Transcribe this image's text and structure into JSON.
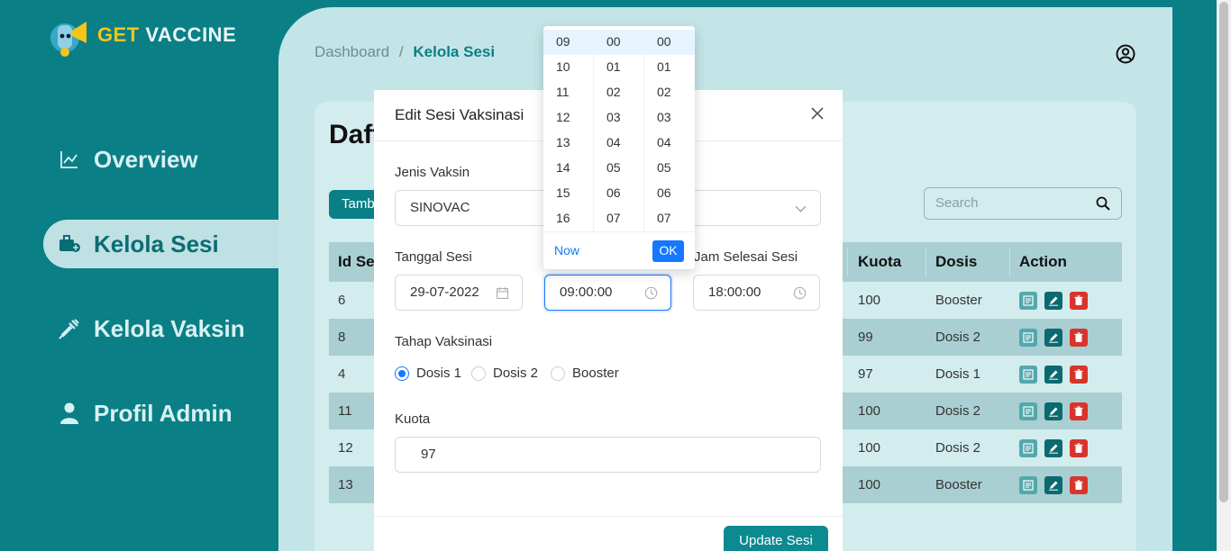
{
  "brand": {
    "logo_part1": "GET",
    "logo_part2": "VACCINE"
  },
  "sidebar": {
    "items": [
      {
        "label": "Overview",
        "icon": "chart-line-icon"
      },
      {
        "label": "Kelola Sesi",
        "icon": "briefcase-medical-icon",
        "active": true
      },
      {
        "label": "Kelola Vaksin",
        "icon": "syringe-icon"
      },
      {
        "label": "Profil Admin",
        "icon": "user-icon"
      }
    ]
  },
  "breadcrumb": {
    "root": "Dashboard",
    "sep": "/",
    "current": "Kelola Sesi"
  },
  "card": {
    "title": "Daft",
    "add_label": "Tamb",
    "search_placeholder": "Search"
  },
  "table": {
    "headers": {
      "id": "Id Ses",
      "kuota": "Kuota",
      "dosis": "Dosis",
      "action": "Action"
    },
    "rows": [
      {
        "id": "6",
        "kuota": "100",
        "dosis": "Booster"
      },
      {
        "id": "8",
        "kuota": "99",
        "dosis": "Dosis 2"
      },
      {
        "id": "4",
        "kuota": "97",
        "dosis": "Dosis 1"
      },
      {
        "id": "11",
        "kuota": "100",
        "dosis": "Dosis 2"
      },
      {
        "id": "12",
        "kuota": "100",
        "dosis": "Dosis 2"
      },
      {
        "id": "13",
        "kuota": "100",
        "dosis": "Booster"
      }
    ]
  },
  "modal": {
    "title": "Edit Sesi Vaksinasi",
    "jenis_label": "Jenis Vaksin",
    "jenis_value": "SINOVAC",
    "tanggal_label": "Tanggal Sesi",
    "tanggal_value": "29-07-2022",
    "jam_mulai_value": "09:00:00",
    "jam_selesai_label": "Jam Selesai Sesi",
    "jam_selesai_value": "18:00:00",
    "tahap_label": "Tahap Vaksinasi",
    "tahap_options": [
      "Dosis 1",
      "Dosis 2",
      "Booster"
    ],
    "tahap_selected": "Dosis 1",
    "kuota_label": "Kuota",
    "kuota_value": "97",
    "submit_label": "Update Sesi"
  },
  "time_picker": {
    "hours": [
      "09",
      "10",
      "11",
      "12",
      "13",
      "14",
      "15",
      "16"
    ],
    "minutes": [
      "00",
      "01",
      "02",
      "03",
      "04",
      "05",
      "06",
      "07"
    ],
    "seconds": [
      "00",
      "01",
      "02",
      "03",
      "04",
      "05",
      "06",
      "07"
    ],
    "now_label": "Now",
    "ok_label": "OK"
  },
  "colors": {
    "primary": "#0b7f86",
    "accent": "#1677ff",
    "danger": "#d9342b",
    "logo_yellow": "#f5c518"
  }
}
